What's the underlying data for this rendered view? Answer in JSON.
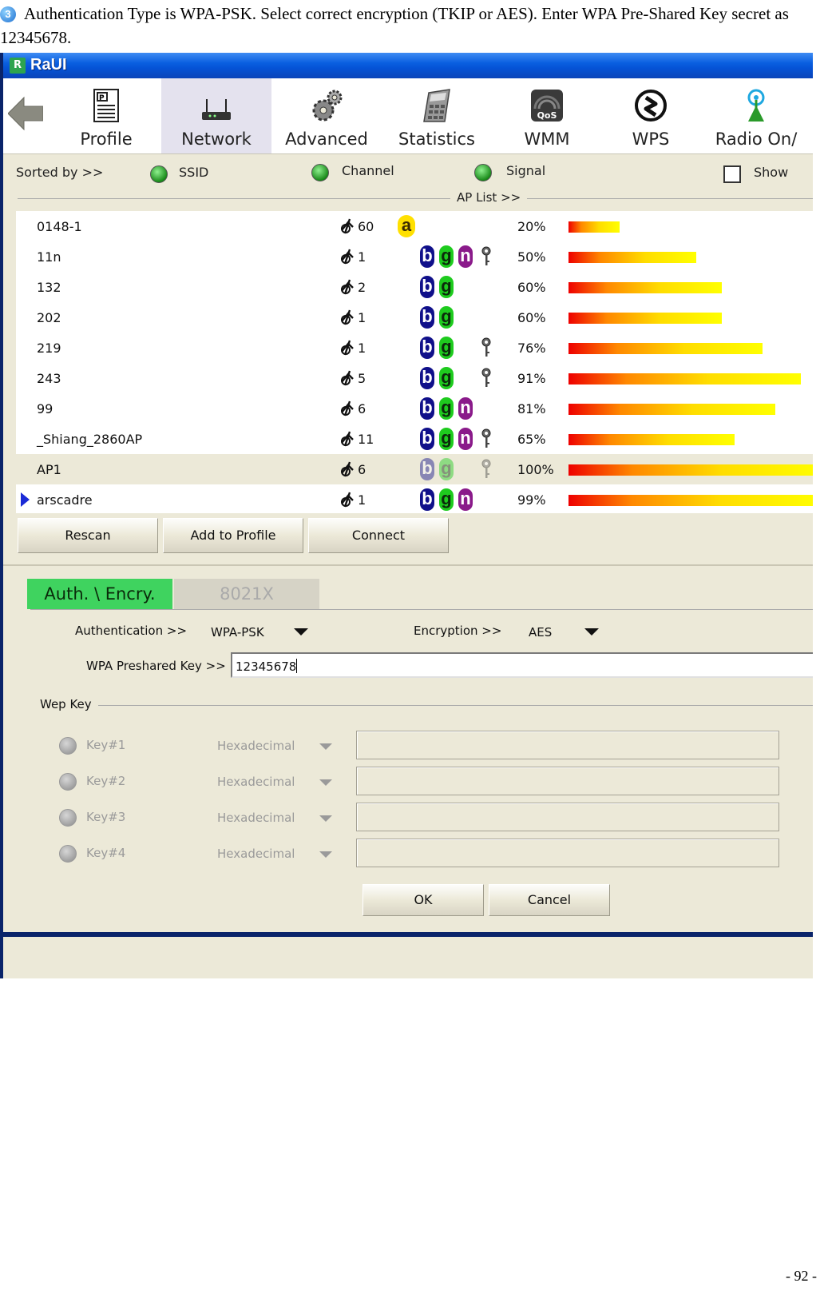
{
  "document": {
    "instruction": "Authentication Type is WPA-PSK. Select correct encryption (TKIP or AES). Enter WPA Pre-Shared Key secret as 12345678.",
    "step_number": "3",
    "page_number": "- 92 -"
  },
  "window": {
    "title": "RaUI",
    "logo": "R"
  },
  "toolbar": {
    "items": [
      {
        "label": "Profile",
        "icon": "profile-icon"
      },
      {
        "label": "Network",
        "icon": "network-icon",
        "active": true
      },
      {
        "label": "Advanced",
        "icon": "gears-icon"
      },
      {
        "label": "Statistics",
        "icon": "calculator-icon"
      },
      {
        "label": "WMM",
        "icon": "qos-icon",
        "badge": "QoS"
      },
      {
        "label": "WPS",
        "icon": "wps-icon"
      },
      {
        "label": "Radio On/",
        "icon": "antenna-icon"
      }
    ]
  },
  "sort": {
    "label": "Sorted by >>",
    "ssid": "SSID",
    "channel": "Channel",
    "signal": "Signal",
    "show": "Show"
  },
  "ap_list": {
    "label": "AP List >>",
    "rows": [
      {
        "ssid": "0148-1",
        "channel": "60",
        "modes": [
          "a"
        ],
        "secured": false,
        "signal": "20%",
        "signal_value": 20
      },
      {
        "ssid": "11n",
        "channel": "1",
        "modes": [
          "b",
          "g",
          "n"
        ],
        "secured": true,
        "signal": "50%",
        "signal_value": 50
      },
      {
        "ssid": "132",
        "channel": "2",
        "modes": [
          "b",
          "g"
        ],
        "secured": false,
        "signal": "60%",
        "signal_value": 60
      },
      {
        "ssid": "202",
        "channel": "1",
        "modes": [
          "b",
          "g"
        ],
        "secured": false,
        "signal": "60%",
        "signal_value": 60
      },
      {
        "ssid": "219",
        "channel": "1",
        "modes": [
          "b",
          "g"
        ],
        "secured": true,
        "signal": "76%",
        "signal_value": 76
      },
      {
        "ssid": "243",
        "channel": "5",
        "modes": [
          "b",
          "g"
        ],
        "secured": true,
        "signal": "91%",
        "signal_value": 91
      },
      {
        "ssid": "99",
        "channel": "6",
        "modes": [
          "b",
          "g",
          "n"
        ],
        "secured": false,
        "signal": "81%",
        "signal_value": 81
      },
      {
        "ssid": "_Shiang_2860AP",
        "channel": "11",
        "modes": [
          "b",
          "g",
          "n"
        ],
        "secured": true,
        "signal": "65%",
        "signal_value": 65
      },
      {
        "ssid": "AP1",
        "channel": "6",
        "modes": [
          "b",
          "g"
        ],
        "secured": true,
        "signal": "100%",
        "signal_value": 100,
        "selected": true
      },
      {
        "ssid": "arscadre",
        "channel": "1",
        "modes": [
          "b",
          "g",
          "n"
        ],
        "secured": false,
        "signal": "99%",
        "signal_value": 99,
        "current": true
      }
    ]
  },
  "actions": {
    "rescan": "Rescan",
    "add_to_profile": "Add to Profile",
    "connect": "Connect"
  },
  "tabs": {
    "auth": "Auth. \\ Encry.",
    "dot1x": "8021X"
  },
  "auth": {
    "authentication_label": "Authentication >>",
    "authentication_value": "WPA-PSK",
    "encryption_label": "Encryption >>",
    "encryption_value": "AES",
    "psk_label": "WPA Preshared Key >>",
    "psk_value": "12345678"
  },
  "wep": {
    "label": "Wep Key",
    "keys": [
      {
        "label": "Key#1",
        "format": "Hexadecimal"
      },
      {
        "label": "Key#2",
        "format": "Hexadecimal"
      },
      {
        "label": "Key#3",
        "format": "Hexadecimal"
      },
      {
        "label": "Key#4",
        "format": "Hexadecimal"
      }
    ]
  },
  "dialog": {
    "ok": "OK",
    "cancel": "Cancel"
  },
  "colors": {
    "titlebar": "#0553d6",
    "active_tab": "#3fd35f",
    "mode_b": "#10108a",
    "mode_g": "#1ecb1e",
    "mode_n": "#8a1a8a",
    "mode_a": "#ffe000"
  }
}
